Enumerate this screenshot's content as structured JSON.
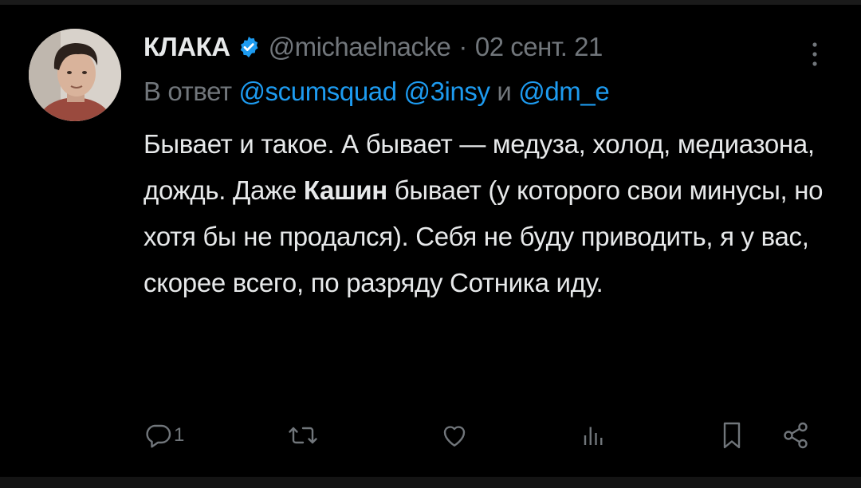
{
  "tweet": {
    "author_name": "КЛАКА",
    "handle": "@michaelnacke",
    "separator": "·",
    "date": "02 сент. 21",
    "reply_prefix": "В ответ",
    "reply_mentions": [
      "@scumsquad",
      "@3insy"
    ],
    "reply_and": "и",
    "reply_last_mention": "@dm_e",
    "text_part1": "Бывает и такое. А бывает — медуза, холод, медиазона, дождь. Даже ",
    "text_bold": "Кашин",
    "text_part2": " бывает (у которого свои минусы, но хотя бы не продался). Себя не буду приводить, я у вас, скорее всего, по разряду Сотника иду.",
    "reply_count": "1"
  },
  "icons": {
    "verified": "verified-badge-icon",
    "more": "more-vertical-icon",
    "reply": "reply-icon",
    "retweet": "retweet-icon",
    "like": "like-icon",
    "views": "views-icon",
    "bookmark": "bookmark-icon",
    "share": "share-icon"
  },
  "colors": {
    "background": "#000000",
    "text": "#e7e9ea",
    "muted": "#71767b",
    "link": "#1d9bf0",
    "verified": "#1d9bf0"
  }
}
